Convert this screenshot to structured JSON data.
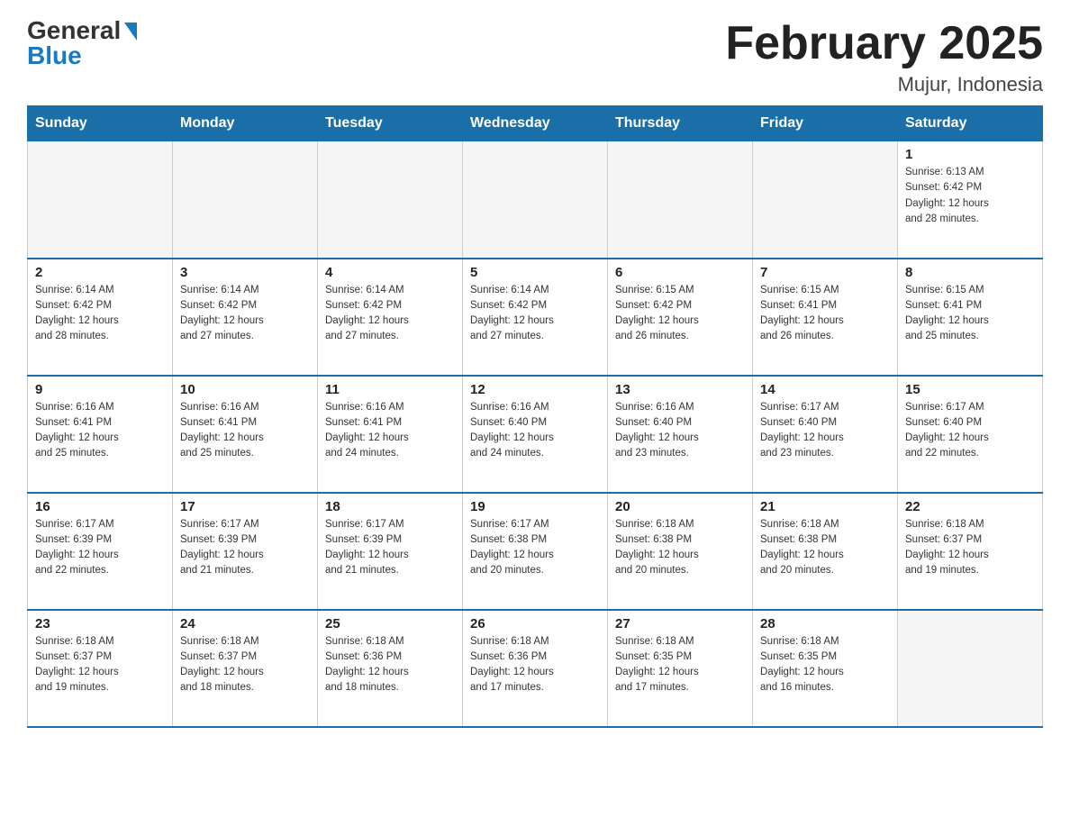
{
  "header": {
    "logo_general": "General",
    "logo_blue": "Blue",
    "title": "February 2025",
    "location": "Mujur, Indonesia"
  },
  "calendar": {
    "days_of_week": [
      "Sunday",
      "Monday",
      "Tuesday",
      "Wednesday",
      "Thursday",
      "Friday",
      "Saturday"
    ],
    "weeks": [
      [
        {
          "day": "",
          "info": "",
          "empty": true
        },
        {
          "day": "",
          "info": "",
          "empty": true
        },
        {
          "day": "",
          "info": "",
          "empty": true
        },
        {
          "day": "",
          "info": "",
          "empty": true
        },
        {
          "day": "",
          "info": "",
          "empty": true
        },
        {
          "day": "",
          "info": "",
          "empty": true
        },
        {
          "day": "1",
          "info": "Sunrise: 6:13 AM\nSunset: 6:42 PM\nDaylight: 12 hours\nand 28 minutes.",
          "empty": false
        }
      ],
      [
        {
          "day": "2",
          "info": "Sunrise: 6:14 AM\nSunset: 6:42 PM\nDaylight: 12 hours\nand 28 minutes.",
          "empty": false
        },
        {
          "day": "3",
          "info": "Sunrise: 6:14 AM\nSunset: 6:42 PM\nDaylight: 12 hours\nand 27 minutes.",
          "empty": false
        },
        {
          "day": "4",
          "info": "Sunrise: 6:14 AM\nSunset: 6:42 PM\nDaylight: 12 hours\nand 27 minutes.",
          "empty": false
        },
        {
          "day": "5",
          "info": "Sunrise: 6:14 AM\nSunset: 6:42 PM\nDaylight: 12 hours\nand 27 minutes.",
          "empty": false
        },
        {
          "day": "6",
          "info": "Sunrise: 6:15 AM\nSunset: 6:42 PM\nDaylight: 12 hours\nand 26 minutes.",
          "empty": false
        },
        {
          "day": "7",
          "info": "Sunrise: 6:15 AM\nSunset: 6:41 PM\nDaylight: 12 hours\nand 26 minutes.",
          "empty": false
        },
        {
          "day": "8",
          "info": "Sunrise: 6:15 AM\nSunset: 6:41 PM\nDaylight: 12 hours\nand 25 minutes.",
          "empty": false
        }
      ],
      [
        {
          "day": "9",
          "info": "Sunrise: 6:16 AM\nSunset: 6:41 PM\nDaylight: 12 hours\nand 25 minutes.",
          "empty": false
        },
        {
          "day": "10",
          "info": "Sunrise: 6:16 AM\nSunset: 6:41 PM\nDaylight: 12 hours\nand 25 minutes.",
          "empty": false
        },
        {
          "day": "11",
          "info": "Sunrise: 6:16 AM\nSunset: 6:41 PM\nDaylight: 12 hours\nand 24 minutes.",
          "empty": false
        },
        {
          "day": "12",
          "info": "Sunrise: 6:16 AM\nSunset: 6:40 PM\nDaylight: 12 hours\nand 24 minutes.",
          "empty": false
        },
        {
          "day": "13",
          "info": "Sunrise: 6:16 AM\nSunset: 6:40 PM\nDaylight: 12 hours\nand 23 minutes.",
          "empty": false
        },
        {
          "day": "14",
          "info": "Sunrise: 6:17 AM\nSunset: 6:40 PM\nDaylight: 12 hours\nand 23 minutes.",
          "empty": false
        },
        {
          "day": "15",
          "info": "Sunrise: 6:17 AM\nSunset: 6:40 PM\nDaylight: 12 hours\nand 22 minutes.",
          "empty": false
        }
      ],
      [
        {
          "day": "16",
          "info": "Sunrise: 6:17 AM\nSunset: 6:39 PM\nDaylight: 12 hours\nand 22 minutes.",
          "empty": false
        },
        {
          "day": "17",
          "info": "Sunrise: 6:17 AM\nSunset: 6:39 PM\nDaylight: 12 hours\nand 21 minutes.",
          "empty": false
        },
        {
          "day": "18",
          "info": "Sunrise: 6:17 AM\nSunset: 6:39 PM\nDaylight: 12 hours\nand 21 minutes.",
          "empty": false
        },
        {
          "day": "19",
          "info": "Sunrise: 6:17 AM\nSunset: 6:38 PM\nDaylight: 12 hours\nand 20 minutes.",
          "empty": false
        },
        {
          "day": "20",
          "info": "Sunrise: 6:18 AM\nSunset: 6:38 PM\nDaylight: 12 hours\nand 20 minutes.",
          "empty": false
        },
        {
          "day": "21",
          "info": "Sunrise: 6:18 AM\nSunset: 6:38 PM\nDaylight: 12 hours\nand 20 minutes.",
          "empty": false
        },
        {
          "day": "22",
          "info": "Sunrise: 6:18 AM\nSunset: 6:37 PM\nDaylight: 12 hours\nand 19 minutes.",
          "empty": false
        }
      ],
      [
        {
          "day": "23",
          "info": "Sunrise: 6:18 AM\nSunset: 6:37 PM\nDaylight: 12 hours\nand 19 minutes.",
          "empty": false
        },
        {
          "day": "24",
          "info": "Sunrise: 6:18 AM\nSunset: 6:37 PM\nDaylight: 12 hours\nand 18 minutes.",
          "empty": false
        },
        {
          "day": "25",
          "info": "Sunrise: 6:18 AM\nSunset: 6:36 PM\nDaylight: 12 hours\nand 18 minutes.",
          "empty": false
        },
        {
          "day": "26",
          "info": "Sunrise: 6:18 AM\nSunset: 6:36 PM\nDaylight: 12 hours\nand 17 minutes.",
          "empty": false
        },
        {
          "day": "27",
          "info": "Sunrise: 6:18 AM\nSunset: 6:35 PM\nDaylight: 12 hours\nand 17 minutes.",
          "empty": false
        },
        {
          "day": "28",
          "info": "Sunrise: 6:18 AM\nSunset: 6:35 PM\nDaylight: 12 hours\nand 16 minutes.",
          "empty": false
        },
        {
          "day": "",
          "info": "",
          "empty": true
        }
      ]
    ]
  }
}
